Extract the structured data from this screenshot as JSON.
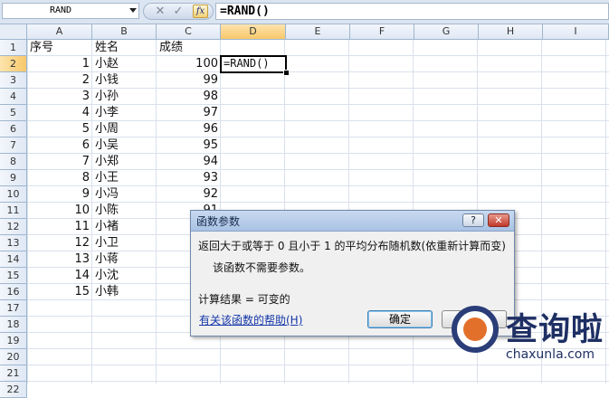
{
  "formula_bar": {
    "name_box": "RAND",
    "cancel_icon": "✕",
    "enter_icon": "✓",
    "fx_label": "fx",
    "formula": "=RAND()"
  },
  "columns": [
    "A",
    "B",
    "C",
    "D",
    "E",
    "F",
    "G",
    "H",
    "I"
  ],
  "rows": [
    "1",
    "2",
    "3",
    "4",
    "5",
    "6",
    "7",
    "8",
    "9",
    "10",
    "11",
    "12",
    "13",
    "14",
    "15",
    "16",
    "17",
    "18",
    "19",
    "20",
    "21",
    "22"
  ],
  "cells": {
    "header": [
      "序号",
      "姓名",
      "成绩"
    ],
    "seq": [
      "1",
      "2",
      "3",
      "4",
      "5",
      "6",
      "7",
      "8",
      "9",
      "10",
      "11",
      "12",
      "13",
      "14",
      "15"
    ],
    "names": [
      "小赵",
      "小钱",
      "小孙",
      "小李",
      "小周",
      "小吴",
      "小郑",
      "小王",
      "小冯",
      "小陈",
      "小褚",
      "小卫",
      "小蒋",
      "小沈",
      "小韩"
    ],
    "scores": [
      "100",
      "99",
      "98",
      "97",
      "96",
      "95",
      "94",
      "93",
      "92",
      "91"
    ],
    "active_cell": "=RAND()"
  },
  "dialog": {
    "title": "函数参数",
    "help_button": "?",
    "close_button": "✕",
    "description": "返回大于或等于 0 且小于 1 的平均分布随机数(依重新计算而变)",
    "no_args": "该函数不需要参数。",
    "result": "计算结果 =  可变的",
    "help_link": "有关该函数的帮助(H)",
    "ok": "确定"
  },
  "watermark": {
    "brand": "查询啦",
    "domain": "chaxunla.com"
  },
  "colors": {
    "header_bg": "#dfe8f4",
    "active_header": "#f8c86b",
    "grid_line": "#dae1ec",
    "dialog_title": "#a9c2e4",
    "brand_navy": "#1e2f63",
    "brand_orange": "#e3702a"
  }
}
